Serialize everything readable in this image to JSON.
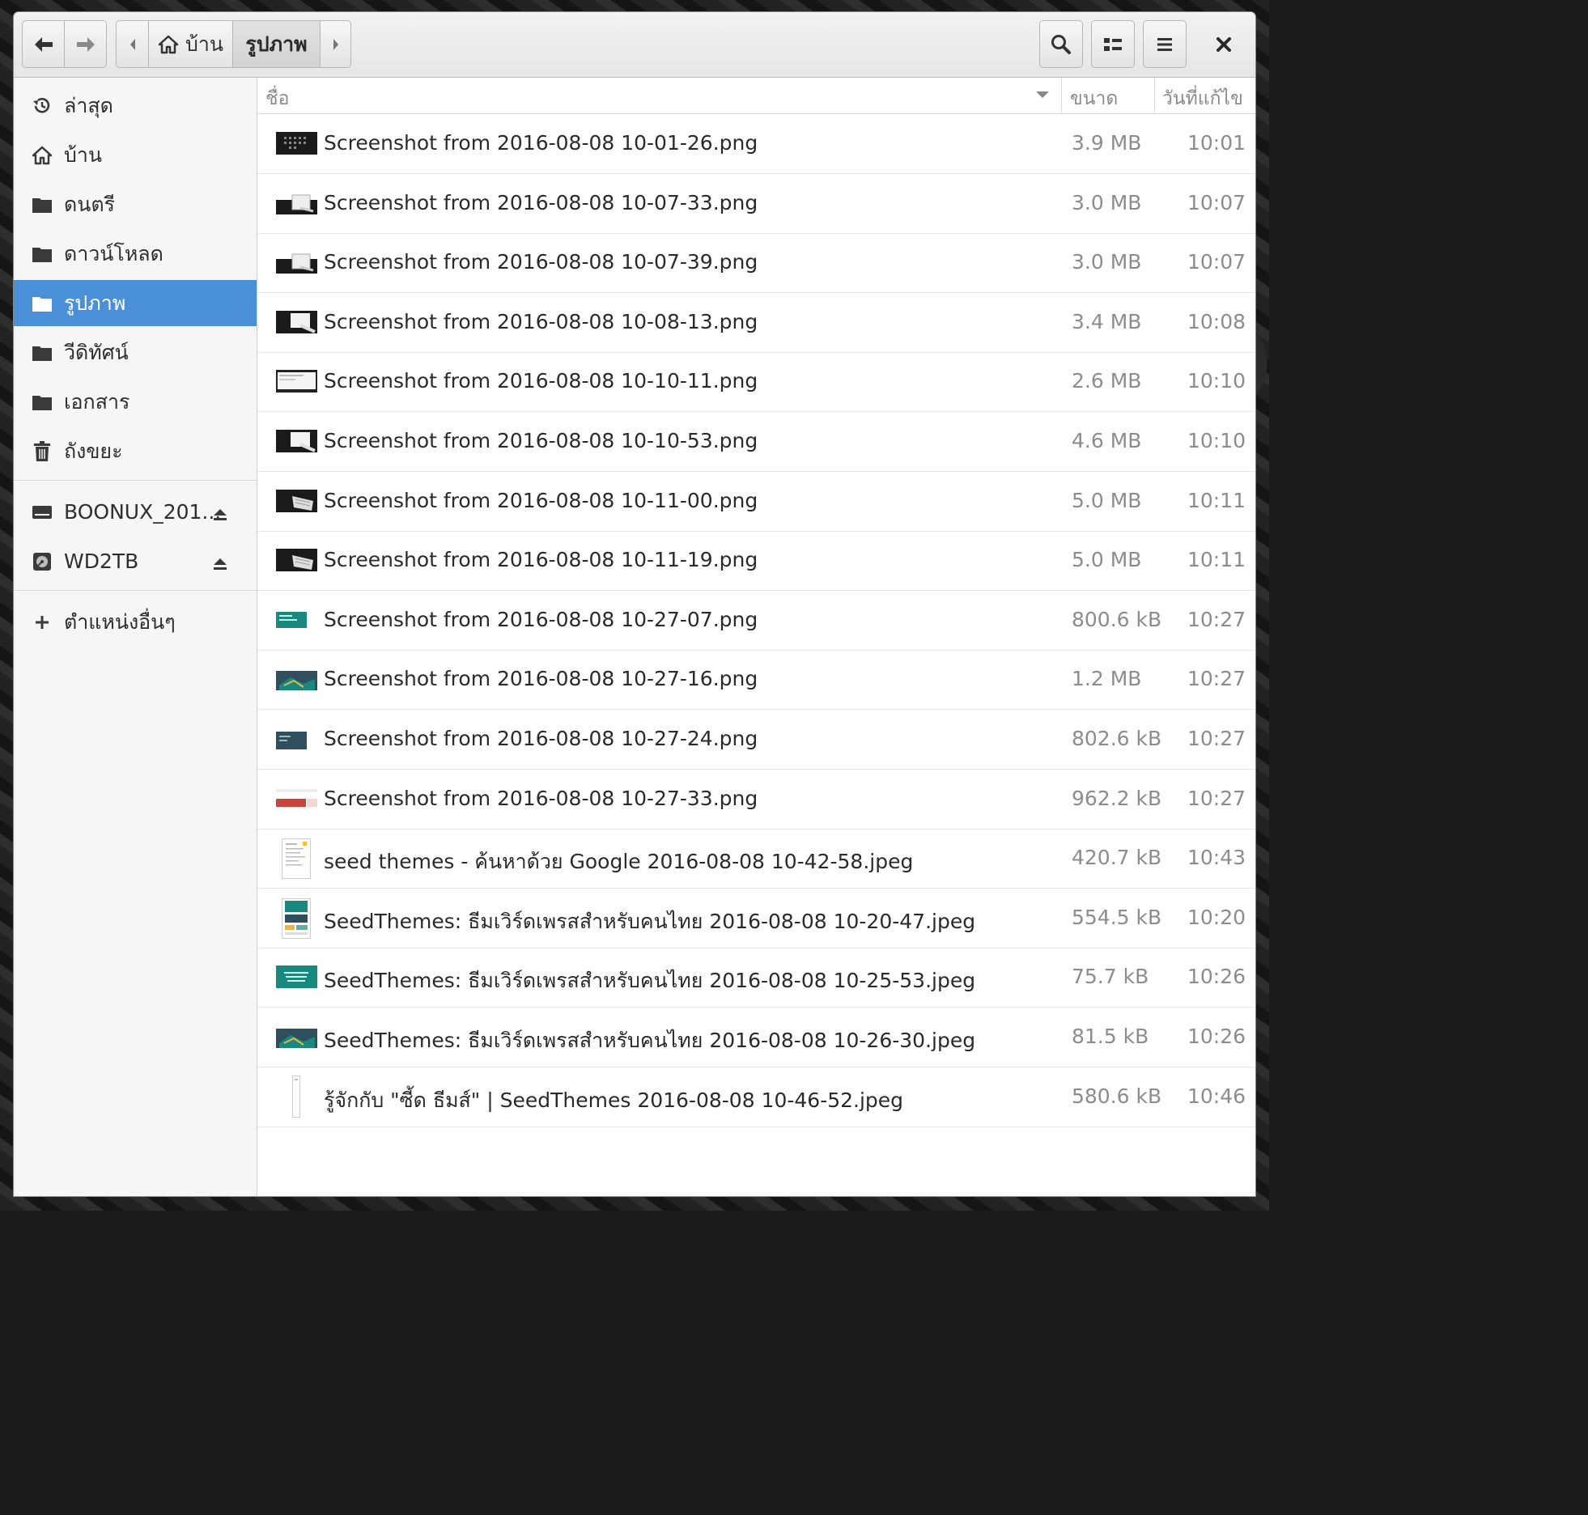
{
  "toolbar": {
    "back_icon": "back-arrow-icon",
    "forward_icon": "forward-arrow-icon",
    "search_icon": "search-icon",
    "view_icon": "view-toggle-icon",
    "menu_icon": "hamburger-menu-icon",
    "close_icon": "close-icon"
  },
  "pathbar": {
    "home": "บ้าน",
    "current": "รูปภาพ"
  },
  "sidebar": {
    "places": [
      {
        "label": "ล่าสุด",
        "icon": "recent-icon"
      },
      {
        "label": "บ้าน",
        "icon": "home-icon"
      },
      {
        "label": "ดนตรี",
        "icon": "folder-icon"
      },
      {
        "label": "ดาวน์โหลด",
        "icon": "folder-icon"
      },
      {
        "label": "รูปภาพ",
        "icon": "folder-icon",
        "active": true
      },
      {
        "label": "วีดิทัศน์",
        "icon": "folder-icon"
      },
      {
        "label": "เอกสาร",
        "icon": "folder-icon"
      },
      {
        "label": "ถังขยะ",
        "icon": "trash-icon"
      }
    ],
    "devices": [
      {
        "label": "BOONUX_201...",
        "icon": "drive-icon"
      },
      {
        "label": "WD2TB",
        "icon": "disk-icon"
      }
    ],
    "other": {
      "label": "ตำแหน่งอื่นๆ",
      "icon": "plus-icon"
    }
  },
  "columns": {
    "name": "ชื่อ",
    "size": "ขนาด",
    "modified": "วันที่แก้ไข"
  },
  "colors": {
    "accent": "#4a90d9",
    "thumb_dark": "#1a1a1a",
    "thumb_teal": "#17897e",
    "thumb_slate": "#2f4f5f",
    "thumb_red": "#c9443a"
  },
  "files": [
    {
      "name": "Screenshot from 2016-08-08 10-01-26.png",
      "size": "3.9 MB",
      "time": "10:01"
    },
    {
      "name": "Screenshot from 2016-08-08 10-07-33.png",
      "size": "3.0 MB",
      "time": "10:07"
    },
    {
      "name": "Screenshot from 2016-08-08 10-07-39.png",
      "size": "3.0 MB",
      "time": "10:07"
    },
    {
      "name": "Screenshot from 2016-08-08 10-08-13.png",
      "size": "3.4 MB",
      "time": "10:08"
    },
    {
      "name": "Screenshot from 2016-08-08 10-10-11.png",
      "size": "2.6 MB",
      "time": "10:10"
    },
    {
      "name": "Screenshot from 2016-08-08 10-10-53.png",
      "size": "4.6 MB",
      "time": "10:10"
    },
    {
      "name": "Screenshot from 2016-08-08 10-11-00.png",
      "size": "5.0 MB",
      "time": "10:11"
    },
    {
      "name": "Screenshot from 2016-08-08 10-11-19.png",
      "size": "5.0 MB",
      "time": "10:11"
    },
    {
      "name": "Screenshot from 2016-08-08 10-27-07.png",
      "size": "800.6 kB",
      "time": "10:27"
    },
    {
      "name": "Screenshot from 2016-08-08 10-27-16.png",
      "size": "1.2 MB",
      "time": "10:27"
    },
    {
      "name": "Screenshot from 2016-08-08 10-27-24.png",
      "size": "802.6 kB",
      "time": "10:27"
    },
    {
      "name": "Screenshot from 2016-08-08 10-27-33.png",
      "size": "962.2 kB",
      "time": "10:27"
    },
    {
      "name": "seed themes - ค้นหาด้วย Google 2016-08-08 10-42-58.jpeg",
      "size": "420.7 kB",
      "time": "10:43"
    },
    {
      "name": "SeedThemes: ธีมเวิร์ดเพรสสำหรับคนไทย 2016-08-08 10-20-47.jpeg",
      "size": "554.5 kB",
      "time": "10:20"
    },
    {
      "name": "SeedThemes: ธีมเวิร์ดเพรสสำหรับคนไทย 2016-08-08 10-25-53.jpeg",
      "size": "75.7 kB",
      "time": "10:26"
    },
    {
      "name": "SeedThemes: ธีมเวิร์ดเพรสสำหรับคนไทย 2016-08-08 10-26-30.jpeg",
      "size": "81.5 kB",
      "time": "10:26"
    },
    {
      "name": "รู้จักกับ \"ซี้ด ธีมส์\" | SeedThemes 2016-08-08 10-46-52.jpeg",
      "size": "580.6 kB",
      "time": "10:46"
    }
  ]
}
